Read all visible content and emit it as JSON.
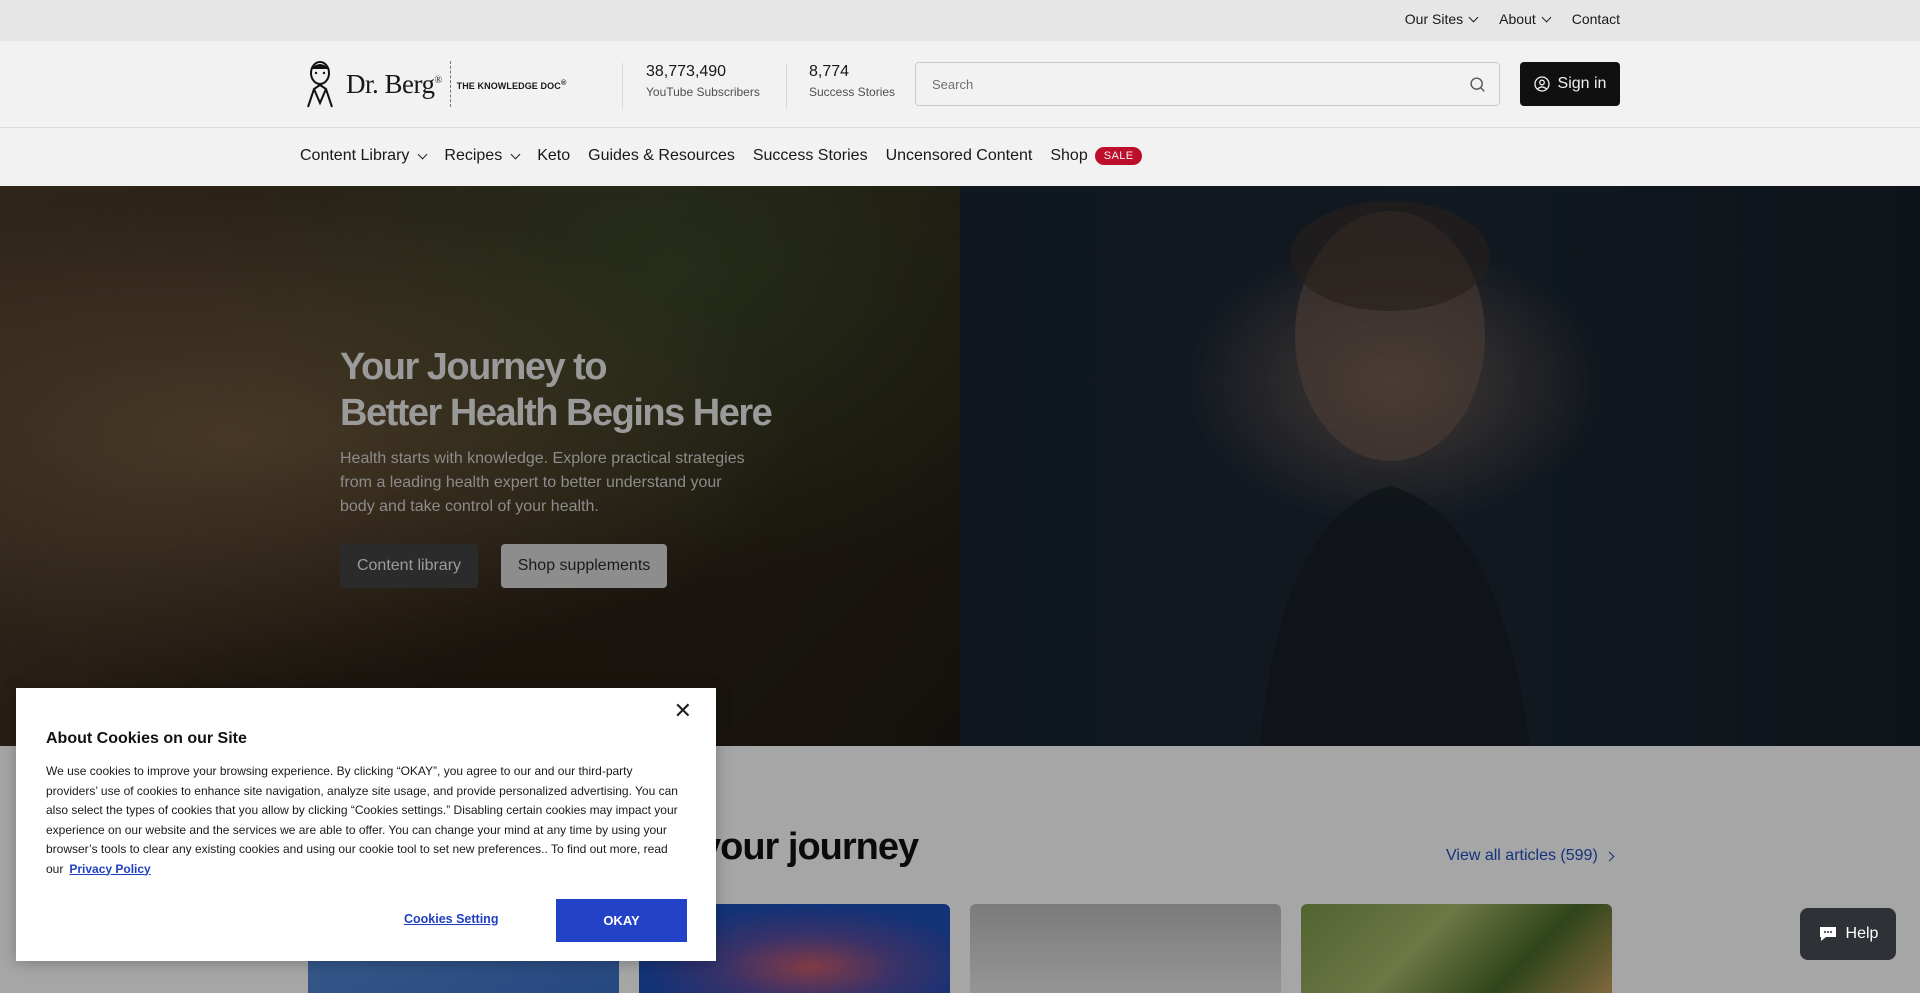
{
  "utility_nav": {
    "our_sites": "Our Sites",
    "about": "About",
    "contact": "Contact"
  },
  "header": {
    "logo": {
      "brand": "Dr. Berg",
      "reg": "®",
      "tagline": "THE KNOWLEDGE DOC",
      "tagline_reg": "®"
    },
    "stats": [
      {
        "value": "38,773,490",
        "label": "YouTube Subscribers"
      },
      {
        "value": "8,774",
        "label": "Success Stories"
      }
    ],
    "search": {
      "placeholder": "Search",
      "icon": "search-icon"
    },
    "sign_in": {
      "label": "Sign in",
      "icon": "user-circle-icon"
    }
  },
  "main_nav": {
    "items": [
      {
        "label": "Content Library",
        "has_dropdown": true
      },
      {
        "label": "Recipes",
        "has_dropdown": true
      },
      {
        "label": "Keto",
        "has_dropdown": false
      },
      {
        "label": "Guides & Resources",
        "has_dropdown": false
      },
      {
        "label": "Success Stories",
        "has_dropdown": false
      },
      {
        "label": "Uncensored Content",
        "has_dropdown": false
      },
      {
        "label": "Shop",
        "has_dropdown": false
      }
    ],
    "sale_badge": "SALE"
  },
  "hero": {
    "title_line1": "Your Journey to",
    "title_line2": "Better Health Begins Here",
    "description": "Health starts with knowledge. Explore practical strategies from a leading health expert to better understand your body and take control of your health.",
    "buttons": {
      "content_library": "Content library",
      "shop_supplements": "Shop supplements"
    }
  },
  "articles": {
    "heading_visible": "your journey",
    "view_all": "View all articles (599)"
  },
  "help_button": {
    "label": "Help",
    "icon": "chat-icon"
  },
  "cookie_banner": {
    "title": "About Cookies on our Site",
    "body": "We use cookies to improve your browsing experience. By clicking “OKAY”, you agree to our and our third-party providers’ use of cookies to enhance site navigation, analyze site usage, and provide personalized advertising. You can also select the types of cookies that you allow by clicking “Cookies settings.” Disabling certain cookies may impact your experience on our website and the services we are able to offer. You can change your mind at any time by using your browser’s tools to clear any existing cookies and using our cookie tool to set new preferences.. To find out more, read our",
    "privacy_link": "Privacy Policy",
    "settings_button": "Cookies Setting",
    "okay_button": "OKAY",
    "close_icon": "close-icon",
    "close_glyph": "✕"
  },
  "colors": {
    "accent_blue": "#2242c7",
    "link_blue": "#1f4fc2",
    "sale_red": "#c8102e",
    "dark_button": "#111111"
  }
}
